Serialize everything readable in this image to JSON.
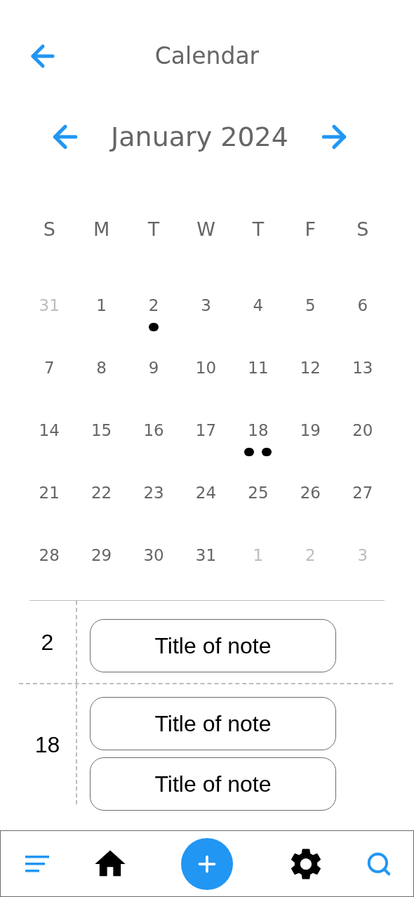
{
  "header": {
    "title": "Calendar"
  },
  "month": {
    "label": "January 2024"
  },
  "weekdays": [
    "S",
    "M",
    "T",
    "W",
    "T",
    "F",
    "S"
  ],
  "weeks": [
    [
      {
        "day": "31",
        "muted": true
      },
      {
        "day": "1",
        "muted": false
      },
      {
        "day": "2",
        "muted": false,
        "dots": [
          {
            "kind": "event"
          }
        ]
      },
      {
        "day": "3",
        "muted": false
      },
      {
        "day": "4",
        "muted": false
      },
      {
        "day": "5",
        "muted": false
      },
      {
        "day": "6",
        "muted": false
      }
    ],
    [
      {
        "day": "7",
        "muted": false
      },
      {
        "day": "8",
        "muted": false
      },
      {
        "day": "9",
        "muted": false
      },
      {
        "day": "10",
        "muted": false
      },
      {
        "day": "11",
        "muted": false
      },
      {
        "day": "12",
        "muted": false
      },
      {
        "day": "13",
        "muted": false
      }
    ],
    [
      {
        "day": "14",
        "muted": false
      },
      {
        "day": "15",
        "muted": false
      },
      {
        "day": "16",
        "muted": false
      },
      {
        "day": "17",
        "muted": false
      },
      {
        "day": "18",
        "muted": false,
        "dots": [
          {
            "kind": "event"
          },
          {
            "kind": "event"
          }
        ]
      },
      {
        "day": "19",
        "muted": false
      },
      {
        "day": "20",
        "muted": false
      }
    ],
    [
      {
        "day": "21",
        "muted": false
      },
      {
        "day": "22",
        "muted": false
      },
      {
        "day": "23",
        "muted": false
      },
      {
        "day": "24",
        "muted": false
      },
      {
        "day": "25",
        "muted": false
      },
      {
        "day": "26",
        "muted": false
      },
      {
        "day": "27",
        "muted": false
      }
    ],
    [
      {
        "day": "28",
        "muted": false
      },
      {
        "day": "29",
        "muted": false
      },
      {
        "day": "30",
        "muted": false
      },
      {
        "day": "31",
        "muted": false
      },
      {
        "day": "1",
        "muted": true
      },
      {
        "day": "2",
        "muted": true
      },
      {
        "day": "3",
        "muted": true
      }
    ]
  ],
  "note_groups": [
    {
      "day": "2",
      "notes": [
        "Title of note"
      ]
    },
    {
      "day": "18",
      "notes": [
        "Title of note",
        "Title of note"
      ]
    }
  ],
  "nav": [
    {
      "kind": "menu"
    },
    {
      "kind": "home"
    },
    {
      "kind": "add"
    },
    {
      "kind": "settings"
    },
    {
      "kind": "search"
    }
  ]
}
